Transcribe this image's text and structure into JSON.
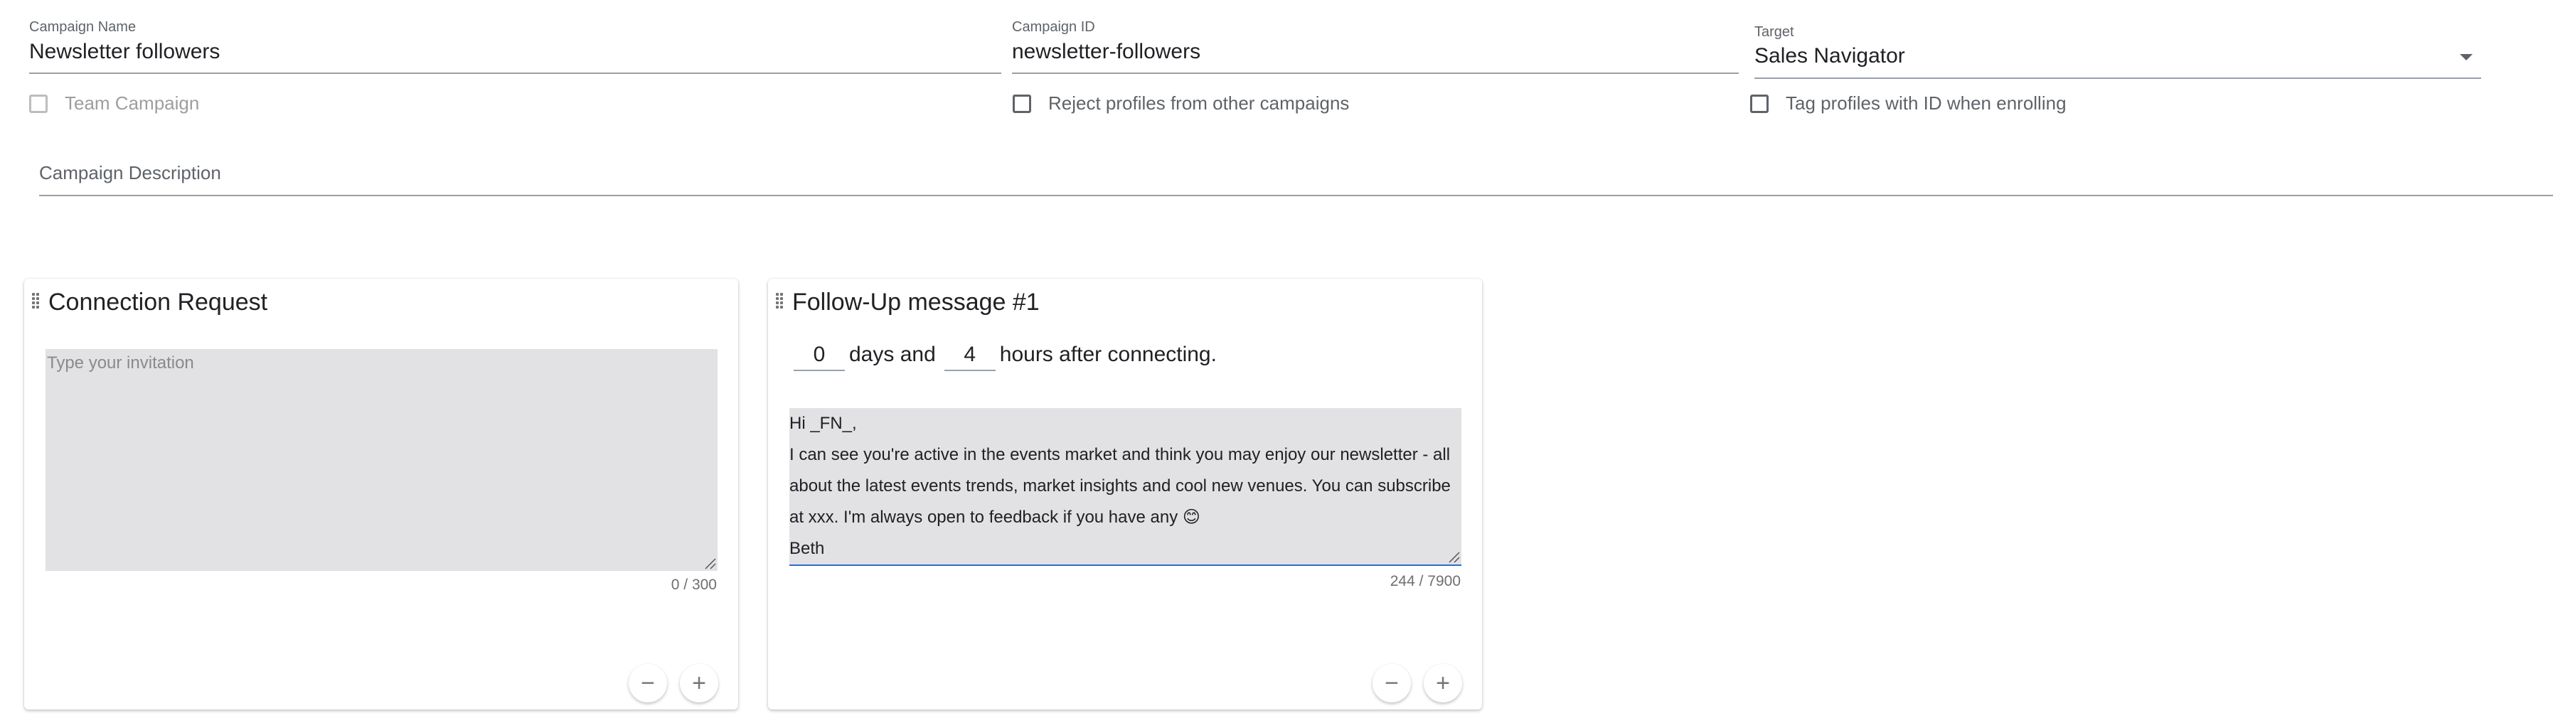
{
  "form": {
    "campaign_name": {
      "label": "Campaign Name",
      "value": "Newsletter followers"
    },
    "campaign_id": {
      "label": "Campaign ID",
      "value": "newsletter-followers"
    },
    "target": {
      "label": "Target",
      "value": "Sales Navigator"
    },
    "team_campaign": {
      "label": "Team Campaign",
      "checked": false,
      "disabled": true
    },
    "reject_profiles": {
      "label": "Reject profiles from other campaigns",
      "checked": false
    },
    "tag_profiles": {
      "label": "Tag profiles with ID when enrolling",
      "checked": false
    },
    "description": {
      "label": "Campaign Description",
      "value": ""
    }
  },
  "cards": {
    "connection": {
      "title": "Connection Request",
      "placeholder": "Type your invitation",
      "counter": "0 / 300"
    },
    "followup": {
      "title": "Follow-Up message #1",
      "days": "0",
      "days_text": "days and",
      "hours": "4",
      "hours_text": "hours after connecting.",
      "message_lines": [
        "Hi _FN_,",
        "I can see you're active in the events market and think you may enjoy our newsletter - all",
        "about the latest events trends, market insights and cool new venues. You can subscribe",
        "at xxx. I'm always open to feedback if you have any 😊",
        "Beth"
      ],
      "counter": "244 / 7900"
    }
  },
  "icons": {
    "minus": "−",
    "plus": "+",
    "dropdown": "arrow-drop-down-icon",
    "drag": "drag-handle-icon"
  },
  "colors": {
    "textarea_bg": "#e2e1e3",
    "focus_underline": "#1a73e8"
  }
}
